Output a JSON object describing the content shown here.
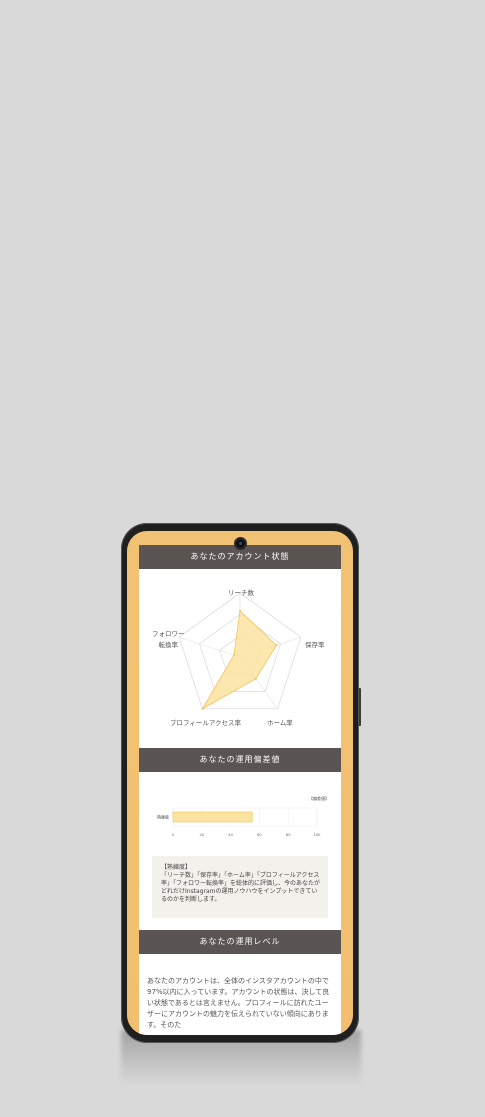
{
  "sections": {
    "account_status": {
      "title": "あなたのアカウント状態"
    },
    "deviation": {
      "title": "あなたの運用偏差値"
    },
    "level": {
      "title": "あなたの運用レベル"
    }
  },
  "colors": {
    "page_bg": "#d9d9d9",
    "phone_frame": "#1f1f1f",
    "screen_bg": "#f2c274",
    "header_bar": "#5a5552",
    "radar_fill": "#fbe3a0",
    "radar_stroke": "#f0c35a"
  },
  "chart_data": [
    {
      "type": "radar",
      "axes": [
        "リーチ数",
        "保存率",
        "ホーム率",
        "プロフィールアクセス率",
        "フォロワー\n転換率"
      ],
      "axis_labels": {
        "reach": "リーチ数",
        "save": "保存率",
        "home": "ホーム率",
        "profile": "プロフィールアクセス率",
        "follower_line1": "フォロワー",
        "follower_line2": "転換率"
      },
      "values": [
        0.72,
        0.6,
        0.42,
        1.0,
        0.1
      ],
      "range": [
        0,
        1
      ],
      "grid_levels": 3
    },
    {
      "type": "bar",
      "orientation": "horizontal",
      "categories": [
        "熟練度"
      ],
      "values": [
        55
      ],
      "xlim": [
        0,
        100
      ],
      "ticks": [
        "0",
        "20",
        "40",
        "60",
        "80",
        "100"
      ],
      "legend": "【偏差値】"
    }
  ],
  "note": {
    "title": "【熟練度】",
    "body": "「リーチ数」「保存率」「ホーム率」「プロフィールアクセス率」「フォロワー転換率」を総体的に評価し、今のあなたがどれだけInstagramの運用ノウハウをインプットできているのかを判断します。"
  },
  "level_text": "あなたのアカウントは、全体のインスタアカウントの中で97%以内に入っています。アカウントの状態は、決して良い状態であるとは言えません。プロフィールに訪れたユーザーにアカウントの魅力を伝えられていない傾向にあります。そのた"
}
